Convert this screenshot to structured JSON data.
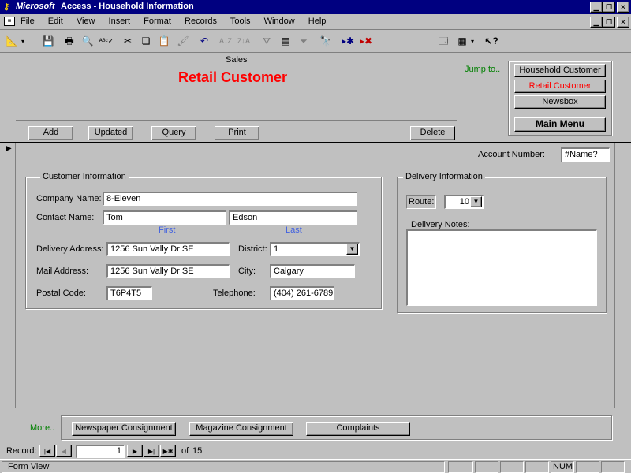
{
  "app": {
    "title_brand": "Microsoft",
    "title_rest": "Access - Household Information"
  },
  "menu": [
    "File",
    "Edit",
    "View",
    "Insert",
    "Format",
    "Records",
    "Tools",
    "Window",
    "Help"
  ],
  "toolbar": {
    "icons": [
      "design-view-icon",
      "save-icon",
      "print-icon",
      "print-preview-icon",
      "spell-check-icon",
      "cut-icon",
      "copy-icon",
      "paste-icon",
      "format-painter-icon",
      "undo-icon",
      "sort-ascending-icon",
      "sort-descending-icon",
      "filter-by-selection-icon",
      "filter-by-form-icon",
      "apply-filter-icon",
      "find-icon",
      "new-record-icon",
      "delete-record-icon",
      "database-window-icon",
      "new-object-icon",
      "help-icon"
    ]
  },
  "header": {
    "section": "Sales",
    "title": "Retail Customer",
    "title_color": "#ff0000",
    "jump_to": "Jump to..",
    "jump_color": "#008000"
  },
  "nav": {
    "household": "Household Customer",
    "retail": "Retail Customer",
    "newsbox": "Newsbox",
    "main_menu": "Main Menu"
  },
  "actions": {
    "add": "Add",
    "updated": "Updated",
    "query": "Query",
    "print": "Print",
    "delete": "Delete"
  },
  "account": {
    "label": "Account Number:",
    "value": "#Name?"
  },
  "customer": {
    "legend": "Customer Information",
    "company_label": "Company Name:",
    "company": "8-Eleven",
    "contact_label": "Contact Name:",
    "first_name": "Tom",
    "last_name": "Edson",
    "first_caption": "First",
    "last_caption": "Last",
    "delivery_label": "Delivery Address:",
    "delivery_address": "1256 Sun Vally Dr SE",
    "district_label": "District:",
    "district": "1",
    "mail_label": "Mail Address:",
    "mail_address": "1256 Sun Vally Dr SE",
    "city_label": "City:",
    "city": "Calgary",
    "postal_label": "Postal Code:",
    "postal": "T6P4T5",
    "phone_label": "Telephone:",
    "phone": "(404) 261-6789"
  },
  "delivery": {
    "legend": "Delivery Information",
    "route_label": "Route:",
    "route": "10",
    "notes_label": "Delivery Notes:",
    "notes": ""
  },
  "footer": {
    "more": "More..",
    "newspaper": "Newspaper Consignment",
    "magazine": "Magazine Consignment",
    "complaints": "Complaints"
  },
  "record_nav": {
    "label": "Record:",
    "current": "1",
    "of": "of",
    "total": "15"
  },
  "status": {
    "text": "Form View",
    "num": "NUM"
  }
}
